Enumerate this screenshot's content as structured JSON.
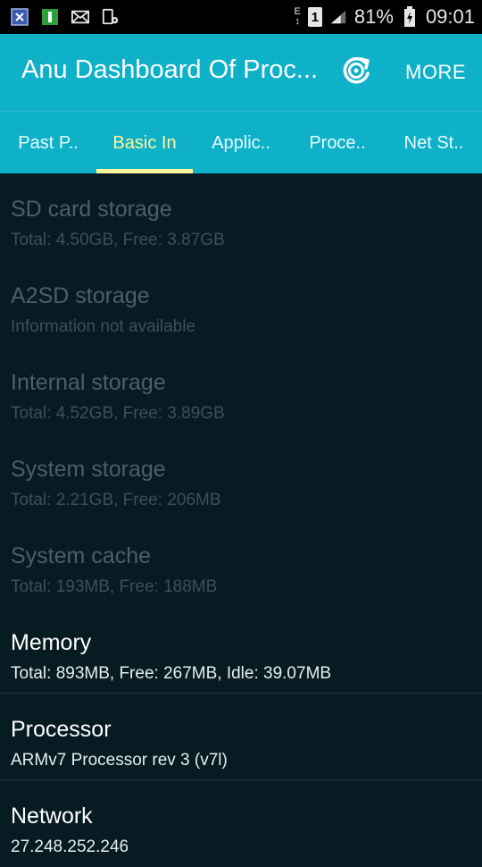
{
  "status_bar": {
    "icons": [
      "x-app-icon",
      "book-icon",
      "mail-icon",
      "phone-settings-icon"
    ],
    "network_letter": "E",
    "sim_label": "1",
    "battery": "81%",
    "time": "09:01"
  },
  "action_bar": {
    "title": "Anu Dashboard Of Proc...",
    "more_label": "MORE"
  },
  "tabs": [
    {
      "label": "Past P..",
      "active": false
    },
    {
      "label": "Basic In",
      "active": true
    },
    {
      "label": "Applic..",
      "active": false
    },
    {
      "label": "Proce..",
      "active": false
    },
    {
      "label": "Net St..",
      "active": false
    }
  ],
  "items": [
    {
      "title": "SD card storage",
      "subtitle": "Total: 4.50GB, Free: 3.87GB",
      "enabled": false
    },
    {
      "title": "A2SD storage",
      "subtitle": "Information not available",
      "enabled": false
    },
    {
      "title": "Internal storage",
      "subtitle": "Total: 4.52GB, Free: 3.89GB",
      "enabled": false
    },
    {
      "title": "System storage",
      "subtitle": "Total: 2.21GB, Free: 206MB",
      "enabled": false
    },
    {
      "title": "System cache",
      "subtitle": "Total: 193MB, Free: 188MB",
      "enabled": false
    },
    {
      "title": "Memory",
      "subtitle": "Total: 893MB, Free: 267MB, Idle: 39.07MB",
      "enabled": true
    },
    {
      "title": "Processor",
      "subtitle": "ARMv7 Processor rev 3 (v7l)",
      "enabled": true
    },
    {
      "title": "Network",
      "subtitle": "27.248.252.246",
      "enabled": true
    }
  ],
  "colors": {
    "accent": "#0fb1c8",
    "tab_active": "#fff59d",
    "background": "#071b22"
  }
}
